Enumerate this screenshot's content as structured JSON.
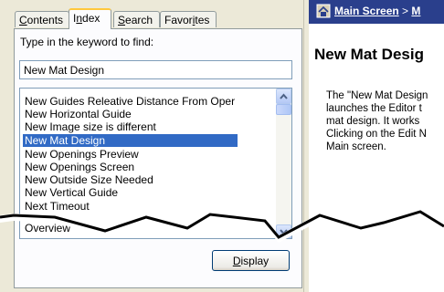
{
  "tabs": [
    {
      "label": "Contents",
      "mnemonic": "C"
    },
    {
      "label": "Index",
      "mnemonic": "n"
    },
    {
      "label": "Search",
      "mnemonic": "S"
    },
    {
      "label": "Favorites",
      "mnemonic": "i"
    }
  ],
  "index": {
    "prompt": "Type in the keyword to find:",
    "keyword_value": "New Mat Design",
    "items": [
      "New Guides Releative Distance From Oper",
      "New Horizontal Guide",
      "New Image size is different",
      "New Mat Design",
      "New Openings Preview",
      "New Openings Screen",
      "New Outside Size Needed",
      "New Vertical Guide",
      "Next Timeout",
      "Overview"
    ],
    "selected_index": 3,
    "display_label": "Display"
  },
  "topic": {
    "breadcrumb": [
      "Main Screen",
      "M"
    ],
    "breadcrumb_separator": ">",
    "title": "New Mat Desig",
    "paragraph": "The \"New Mat Design\nlaunches the Editor t\nmat design. It works \nClicking on the Edit N\nMain screen."
  },
  "colors": {
    "selection": "#316ac5",
    "nav_bar": "#2a3f8c",
    "tab_highlight": "#ffc83c"
  }
}
